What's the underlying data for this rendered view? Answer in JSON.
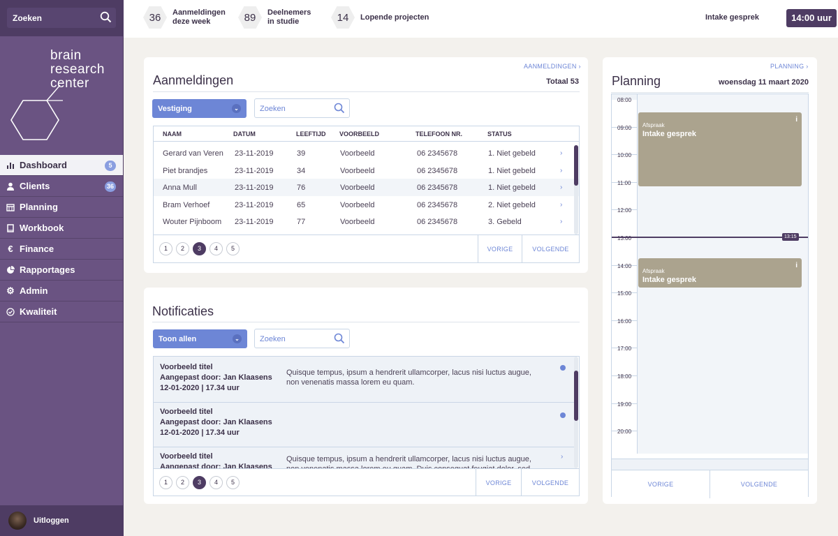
{
  "sidebar": {
    "search_label": "Zoeken",
    "logo": [
      "brain",
      "research",
      "center"
    ],
    "items": [
      {
        "label": "Dashboard",
        "badge": "5",
        "icon": "bar-chart-icon"
      },
      {
        "label": "Clients",
        "badge": "36",
        "icon": "user-icon"
      },
      {
        "label": "Planning",
        "badge": "",
        "icon": "calendar-icon"
      },
      {
        "label": "Workbook",
        "badge": "",
        "icon": "book-icon"
      },
      {
        "label": "Finance",
        "badge": "",
        "icon": "euro-icon"
      },
      {
        "label": "Rapportages",
        "badge": "",
        "icon": "pie-chart-icon"
      },
      {
        "label": "Admin",
        "badge": "",
        "icon": "gear-icon"
      },
      {
        "label": "Kwaliteit",
        "badge": "",
        "icon": "check-circle-icon"
      }
    ],
    "logout_label": "Uitloggen"
  },
  "topbar": {
    "stats": [
      {
        "value": "36",
        "label1": "Aanmeldingen",
        "label2": "deze week"
      },
      {
        "value": "89",
        "label1": "Deelnemers",
        "label2": "in studie"
      },
      {
        "value": "14",
        "label1": "Lopende projecten",
        "label2": ""
      }
    ],
    "intake_label": "Intake gesprek",
    "time": "14:00 uur"
  },
  "aanmeldingen": {
    "link": "AANMELDINGEN",
    "title": "Aanmeldingen",
    "total": "Totaal 53",
    "filter": "Vestiging",
    "search_placeholder": "Zoeken",
    "columns": [
      "NAAM",
      "DATUM",
      "LEEFTIJD",
      "VOORBEELD",
      "TELEFOON NR.",
      "STATUS"
    ],
    "rows": [
      [
        "Gerard van Veren",
        "23-11-2019",
        "39",
        "Voorbeeld",
        "06 2345678",
        "1. Niet gebeld"
      ],
      [
        "Piet brandjes",
        "23-11-2019",
        "34",
        "Voorbeeld",
        "06 2345678",
        "1. Niet gebeld"
      ],
      [
        "Anna Mull",
        "23-11-2019",
        "76",
        "Voorbeeld",
        "06 2345678",
        "1. Niet gebeld"
      ],
      [
        "Bram Verhoef",
        "23-11-2019",
        "65",
        "Voorbeeld",
        "06 2345678",
        "2. Niet gebeld"
      ],
      [
        "Wouter Pijnboom",
        "23-11-2019",
        "77",
        "Voorbeeld",
        "06 2345678",
        "3. Gebeld"
      ]
    ],
    "pages": [
      "1",
      "2",
      "3",
      "4",
      "5"
    ],
    "active_page": "3",
    "prev": "VORIGE",
    "next": "VOLGENDE"
  },
  "notificaties": {
    "title": "Notificaties",
    "filter": "Toon allen",
    "search_placeholder": "Zoeken",
    "items": [
      {
        "title": "Voorbeeld titel",
        "author": "Aangepast door: Jan Klaasens",
        "date": "12-01-2020  | 17.34 uur",
        "text": "Quisque tempus, ipsum a hendrerit ullamcorper, lacus nisi luctus augue, non venenatis massa lorem eu quam."
      },
      {
        "title": "Voorbeeld titel",
        "author": "Aangepast door: Jan Klaasens",
        "date": "12-01-2020  | 17.34 uur",
        "text": ""
      },
      {
        "title": "Voorbeeld titel",
        "author": "Aangepast door: Jan Klaasens",
        "date": "",
        "text": "Quisque tempus, ipsum a hendrerit ullamcorper, lacus nisi luctus augue, non venenatis massa lorem eu quam.  Duis consequat feugiat dolor, sed eleifend nisi"
      }
    ],
    "pages": [
      "1",
      "2",
      "3",
      "4",
      "5"
    ],
    "active_page": "3",
    "prev": "VORIGE",
    "next": "VOLGENDE"
  },
  "planning": {
    "link": "PLANNING",
    "title": "Planning",
    "date": "woensdag 11 maart 2020",
    "hours": [
      "08:00",
      "09:00",
      "10:00",
      "11:00",
      "12:00",
      "13:00",
      "14:00",
      "15:00",
      "16:00",
      "17:00",
      "18:00",
      "19:00",
      "20:00"
    ],
    "now": "13:15",
    "appointments": [
      {
        "small": "Afspraak",
        "label": "Intake gesprek",
        "info": "i"
      },
      {
        "small": "Afspraak",
        "label": "Intake gesprek",
        "info": "i"
      }
    ],
    "prev": "VORIGE",
    "next": "VOLGENDE"
  },
  "colors": {
    "sidebar": "#6a5382",
    "accent": "#6d86d6",
    "dark": "#4e3c63",
    "appointment": "#aba38e"
  }
}
